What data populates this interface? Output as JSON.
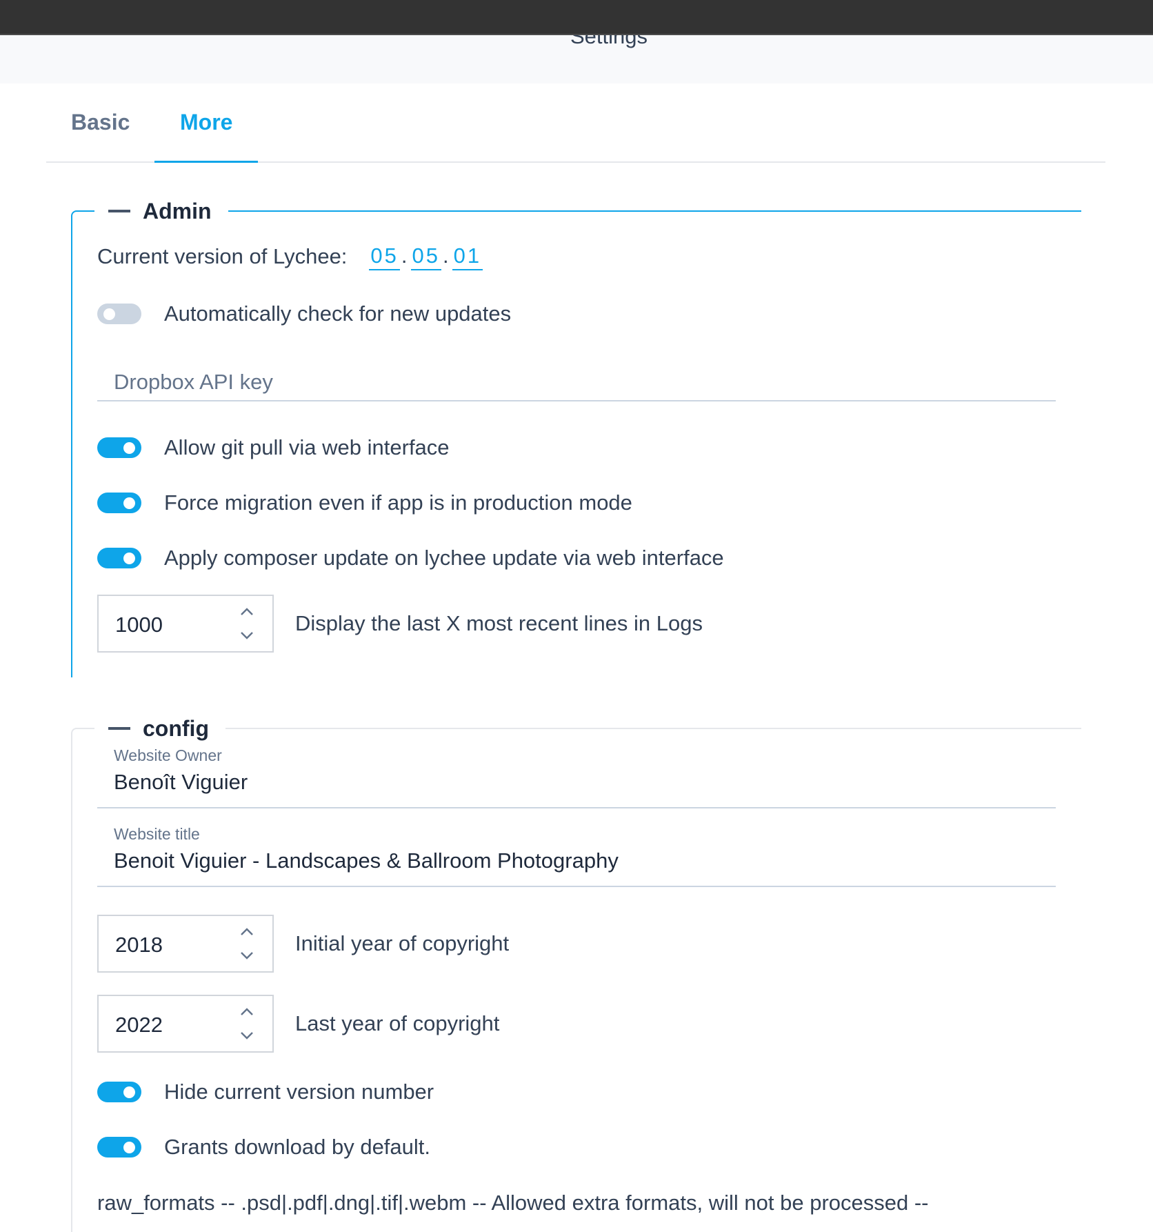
{
  "header": {
    "title": "Settings"
  },
  "tabs": [
    {
      "label": "Basic",
      "active": false
    },
    {
      "label": "More",
      "active": true
    }
  ],
  "admin": {
    "legend": "Admin",
    "version_label": "Current version of Lychee:",
    "version": [
      "05",
      "05",
      "01"
    ],
    "version_separator": ".",
    "auto_check": {
      "label": "Automatically check for new updates",
      "enabled": false
    },
    "dropbox": {
      "placeholder": "Dropbox API key",
      "value": ""
    },
    "git_pull": {
      "label": "Allow git pull via web interface",
      "enabled": true
    },
    "force_migration": {
      "label": "Force migration even if app is in production mode",
      "enabled": true
    },
    "composer_update": {
      "label": "Apply composer update on lychee update via web interface",
      "enabled": true
    },
    "log_lines": {
      "value": "1000",
      "label": "Display the last X most recent lines in Logs"
    }
  },
  "config": {
    "legend": "config",
    "website_owner": {
      "label": "Website Owner",
      "value": "Benoît Viguier"
    },
    "website_title": {
      "label": "Website title",
      "value": "Benoit Viguier - Landscapes & Ballroom Photography"
    },
    "initial_year": {
      "value": "2018",
      "label": "Initial year of copyright"
    },
    "last_year": {
      "value": "2022",
      "label": "Last year of copyright"
    },
    "hide_version": {
      "label": "Hide current version number",
      "enabled": true
    },
    "grants_download": {
      "label": "Grants download by default.",
      "enabled": true
    },
    "raw_formats": "raw_formats -- .psd|.pdf|.dng|.tif|.webm -- Allowed extra formats, will not be processed --"
  },
  "colors": {
    "accent": "#0ea5e9",
    "topbar": "#333333",
    "toggle_off": "#cbd5e1"
  },
  "icons": {
    "spinner_up": "chevron-up-icon",
    "spinner_down": "chevron-down-icon",
    "legend_collapse": "minus-icon"
  }
}
